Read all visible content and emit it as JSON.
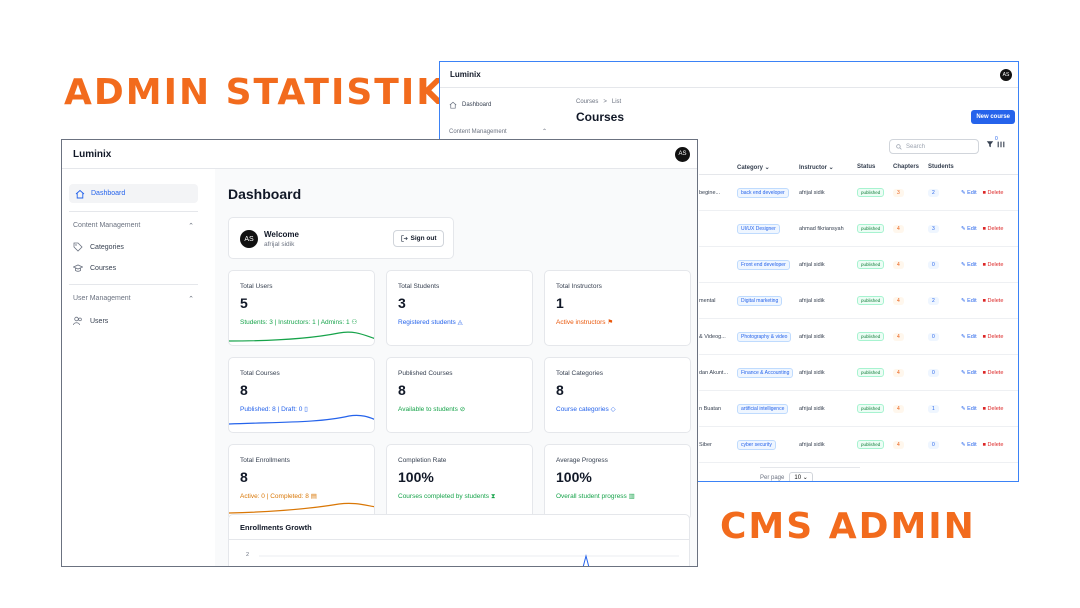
{
  "headlines": {
    "left": "ADMIN STATISTIK",
    "right": "CMS ADMIN"
  },
  "cms": {
    "brand": "Luminix",
    "avatar": "AS",
    "sidebar": {
      "dashboard": "Dashboard",
      "content_management": "Content Management"
    },
    "breadcrumb": {
      "section": "Courses",
      "sep": ">",
      "page": "List"
    },
    "title": "Courses",
    "new_button": "New course",
    "search_placeholder": "Search",
    "filter_count": "0",
    "columns": [
      "Category",
      "Instructor",
      "Status",
      "Chapters",
      "Students"
    ],
    "rows": [
      {
        "title": "begine...",
        "category": "back end developer",
        "instructor": "afrijal sidik",
        "status": "published",
        "chapters": "3",
        "students": "2"
      },
      {
        "title": "",
        "category": "UI/UX Designer",
        "instructor": "ahmad fikriansyah",
        "status": "published",
        "chapters": "4",
        "students": "3"
      },
      {
        "title": "",
        "category": "Front end developer",
        "instructor": "afrijal sidik",
        "status": "published",
        "chapters": "4",
        "students": "0"
      },
      {
        "title": "mental",
        "category": "Digital marketing",
        "instructor": "afrijal sidik",
        "status": "published",
        "chapters": "4",
        "students": "2"
      },
      {
        "title": "& Videog...",
        "category": "Photography & video",
        "instructor": "afrijal sidik",
        "status": "published",
        "chapters": "4",
        "students": "0"
      },
      {
        "title": "dan Akunt...",
        "category": "Finance & Accounting",
        "instructor": "afrijal sidik",
        "status": "published",
        "chapters": "4",
        "students": "0"
      },
      {
        "title": "n Buatan",
        "category": "artificial intelligence",
        "instructor": "afrijal sidik",
        "status": "published",
        "chapters": "4",
        "students": "1"
      },
      {
        "title": "Siber",
        "category": "cyber security",
        "instructor": "afrijal sidik",
        "status": "published",
        "chapters": "4",
        "students": "0"
      }
    ],
    "edit_label": "Edit",
    "delete_label": "Delete",
    "per_page_label": "Per page",
    "per_page_value": "10"
  },
  "dashboard": {
    "brand": "Luminix",
    "avatar": "AS",
    "sidebar": {
      "dashboard": "Dashboard",
      "content_management": "Content Management",
      "categories": "Categories",
      "courses": "Courses",
      "user_management": "User Management",
      "users": "Users"
    },
    "title": "Dashboard",
    "welcome": {
      "avatar": "AS",
      "title": "Welcome",
      "name": "afrijal sidik",
      "signout": "Sign out"
    },
    "cards": [
      {
        "label": "Total Users",
        "value": "5",
        "sub": "Students: 3 | Instructors: 1 | Admins: 1",
        "color": "#16a34a"
      },
      {
        "label": "Total Students",
        "value": "3",
        "sub": "Registered students",
        "color": "#2563eb"
      },
      {
        "label": "Total Instructors",
        "value": "1",
        "sub": "Active instructors",
        "color": "#ea580c"
      },
      {
        "label": "Total Courses",
        "value": "8",
        "sub": "Published: 8 | Draft: 0",
        "color": "#2563eb"
      },
      {
        "label": "Published Courses",
        "value": "8",
        "sub": "Available to students",
        "color": "#16a34a"
      },
      {
        "label": "Total Categories",
        "value": "8",
        "sub": "Course categories",
        "color": "#2563eb"
      },
      {
        "label": "Total Enrollments",
        "value": "8",
        "sub": "Active: 0 | Completed: 8",
        "color": "#d97706"
      },
      {
        "label": "Completion Rate",
        "value": "100%",
        "sub": "Courses completed by students",
        "color": "#16a34a"
      },
      {
        "label": "Average Progress",
        "value": "100%",
        "sub": "Overall student progress",
        "color": "#16a34a"
      }
    ],
    "growth": {
      "title": "Enrollments Growth",
      "y_tick": "2"
    }
  }
}
